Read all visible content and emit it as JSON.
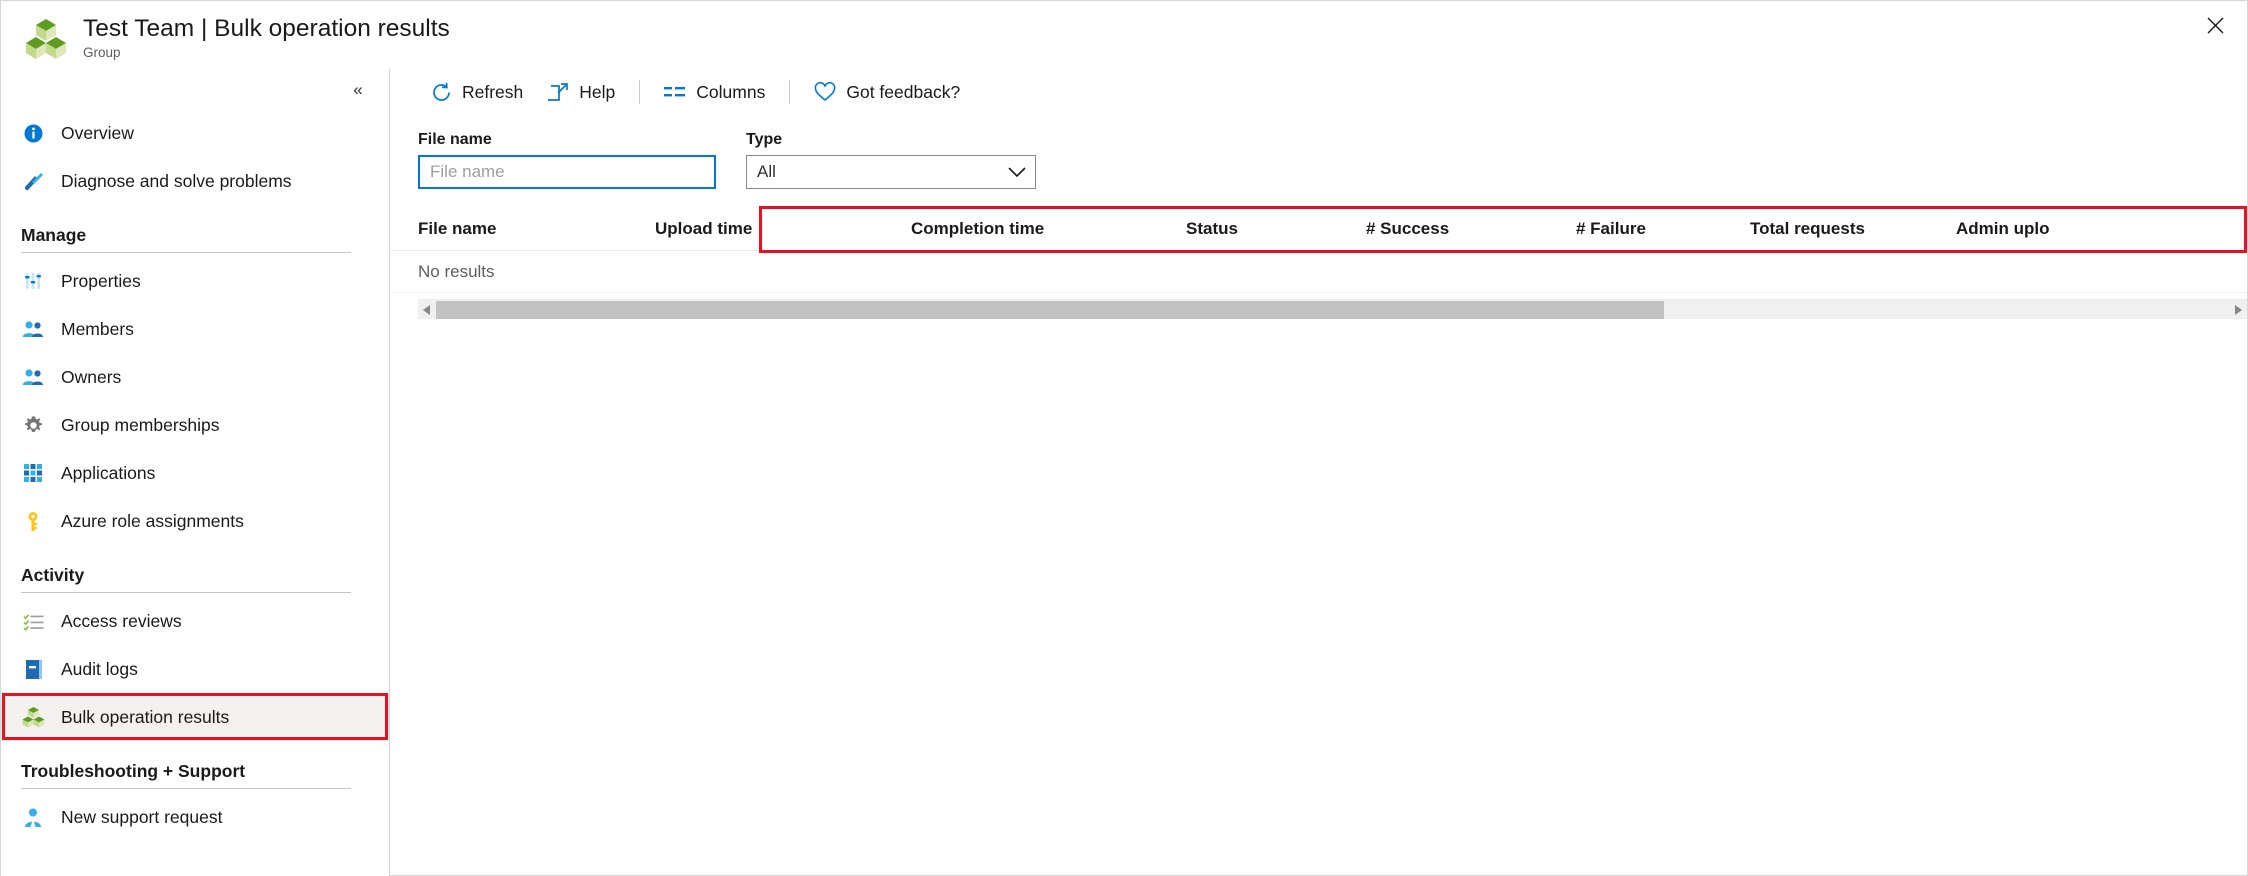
{
  "header": {
    "title": "Test Team | Bulk operation results",
    "subtitle": "Group",
    "icon": "group-cubes-icon",
    "close_label": "✕"
  },
  "sidebar": {
    "collapse_label": "«",
    "top_items": [
      {
        "label": "Overview",
        "icon": "info-icon"
      },
      {
        "label": "Diagnose and solve problems",
        "icon": "wrench-screwdriver-icon"
      }
    ],
    "groups": [
      {
        "title": "Manage",
        "items": [
          {
            "label": "Properties",
            "icon": "sliders-icon"
          },
          {
            "label": "Members",
            "icon": "people-icon"
          },
          {
            "label": "Owners",
            "icon": "people-icon"
          },
          {
            "label": "Group memberships",
            "icon": "gear-icon"
          },
          {
            "label": "Applications",
            "icon": "grid-apps-icon"
          },
          {
            "label": "Azure role assignments",
            "icon": "key-icon"
          }
        ]
      },
      {
        "title": "Activity",
        "items": [
          {
            "label": "Access reviews",
            "icon": "checklist-icon"
          },
          {
            "label": "Audit logs",
            "icon": "book-icon"
          },
          {
            "label": "Bulk operation results",
            "icon": "bulk-cubes-icon",
            "selected": true
          }
        ]
      },
      {
        "title": "Troubleshooting + Support",
        "items": [
          {
            "label": "New support request",
            "icon": "support-person-icon"
          }
        ]
      }
    ]
  },
  "toolbar": {
    "refresh_label": "Refresh",
    "help_label": "Help",
    "columns_label": "Columns",
    "feedback_label": "Got feedback?"
  },
  "filters": {
    "file_name_label": "File name",
    "file_name_value": "",
    "file_name_placeholder": "File name",
    "type_label": "Type",
    "type_value": "All"
  },
  "grid": {
    "columns": [
      "File name",
      "Upload time",
      "Completion time",
      "Status",
      "# Success",
      "# Failure",
      "Total requests",
      "Admin uplo"
    ],
    "empty_message": "No results"
  },
  "colors": {
    "accent": "#0078d4",
    "annotation": "#e81123",
    "selected_bg": "#f3f2f1",
    "text": "#1b1a19",
    "muted": "#605e5c"
  }
}
